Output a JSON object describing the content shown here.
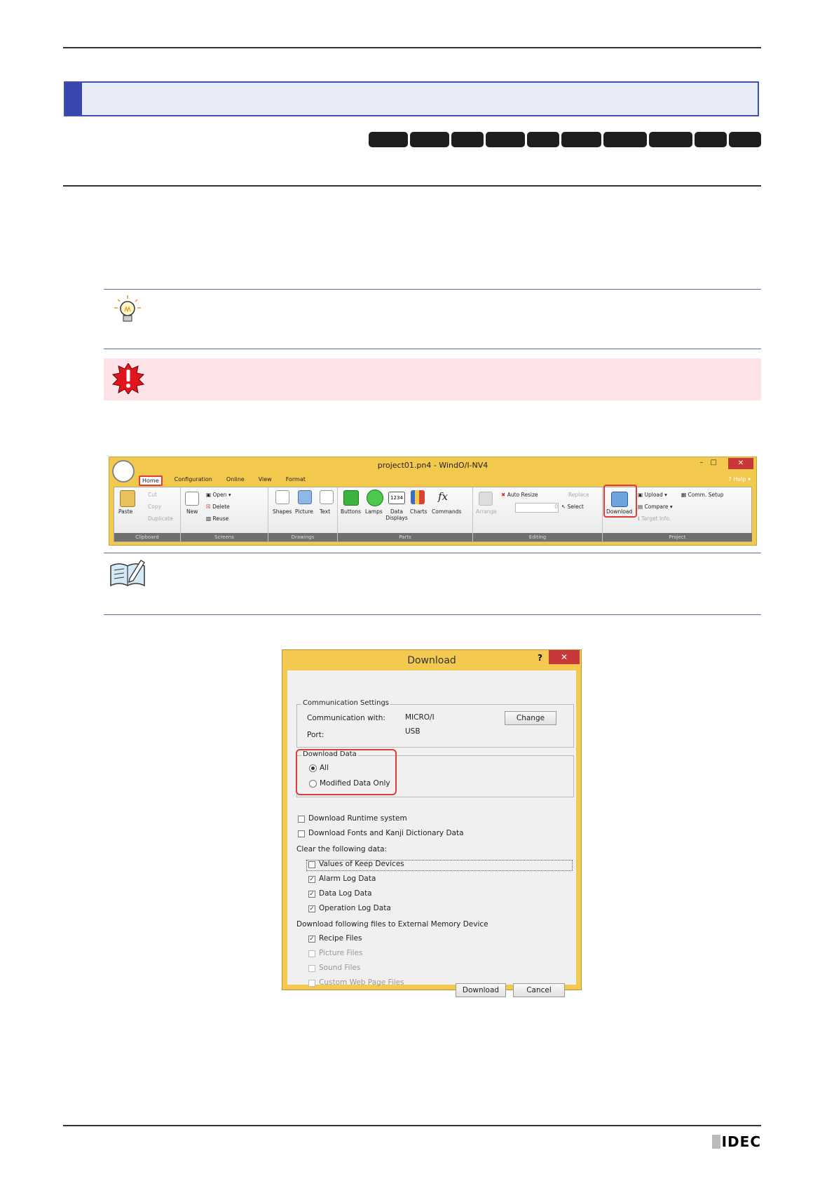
{
  "ribbon": {
    "title": "project01.pn4 - WindO/I-NV4",
    "tabs": [
      "Home",
      "Configuration",
      "Online",
      "View",
      "Format"
    ],
    "help": "Help",
    "clipboard": {
      "paste": "Paste",
      "cut": "Cut",
      "copy": "Copy",
      "duplicate": "Duplicate",
      "group": "Clipboard"
    },
    "screens": {
      "new": "New",
      "open": "Open",
      "delete": "Delete",
      "reuse": "Reuse",
      "group": "Screens"
    },
    "drawings": {
      "shapes": "Shapes",
      "picture": "Picture",
      "text": "Text",
      "group": "Drawings"
    },
    "parts": {
      "buttons": "Buttons",
      "lamps": "Lamps",
      "data_displays": "Data Displays",
      "data_icon": "1234",
      "charts": "Charts",
      "commands": "Commands",
      "commands_icon": "fx",
      "group": "Parts"
    },
    "editing": {
      "arrange": "Arrange",
      "auto_resize": "Auto Resize",
      "replace": "Replace",
      "select": "Select",
      "spin_value": "0",
      "group": "Editing"
    },
    "project": {
      "download": "Download",
      "upload": "Upload",
      "compare": "Compare",
      "comm_setup": "Comm. Setup",
      "target_info": "Target Info.",
      "group": "Project"
    }
  },
  "dialog": {
    "title": "Download",
    "help_mark": "?",
    "close": "✕",
    "comm_settings": {
      "legend": "Communication Settings",
      "comm_with_label": "Communication with:",
      "comm_with_value": "MICRO/I",
      "port_label": "Port:",
      "port_value": "USB",
      "change": "Change"
    },
    "download_data": {
      "legend": "Download Data",
      "all": "All",
      "modified": "Modified Data Only"
    },
    "runtime": "Download Runtime system",
    "fonts": "Download Fonts and Kanji Dictionary Data",
    "clear_label": "Clear the following data:",
    "clear_items": [
      "Values of Keep Devices",
      "Alarm Log Data",
      "Data Log Data",
      "Operation Log Data"
    ],
    "ext_label": "Download following files to External Memory Device",
    "ext_items": [
      "Recipe Files",
      "Picture Files",
      "Sound Files",
      "Custom Web Page Files"
    ],
    "download_btn": "Download",
    "cancel_btn": "Cancel"
  },
  "footer": {
    "logo": "IDEC"
  }
}
